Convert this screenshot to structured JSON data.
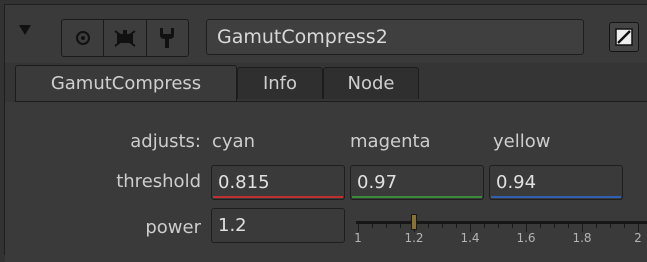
{
  "header": {
    "node_name": "GamutCompress2",
    "icons": [
      "collapse-triangle-icon",
      "viewer-icon",
      "disable-icon",
      "settings-wrench-icon",
      "edit-icon"
    ]
  },
  "tabs": [
    {
      "label": "GamutCompress",
      "active": true
    },
    {
      "label": "Info",
      "active": false
    },
    {
      "label": "Node",
      "active": false
    }
  ],
  "knobs": {
    "adjusts_label": "adjusts:",
    "columns": [
      "cyan",
      "magenta",
      "yellow"
    ],
    "threshold": {
      "label": "threshold",
      "values": [
        "0.815",
        "0.97",
        "0.94"
      ],
      "underline_colors": [
        "#c03030",
        "#3a8a3a",
        "#3060b0"
      ]
    },
    "power": {
      "label": "power",
      "value": "1.2",
      "slider": {
        "min": 1,
        "max": 2,
        "value": 1.2,
        "tick_labels": [
          "1",
          "1.2",
          "1.4",
          "1.6",
          "1.8",
          "2"
        ]
      }
    }
  },
  "colors": {
    "bg": "#3a3a3a",
    "handle": "#8a7236"
  }
}
